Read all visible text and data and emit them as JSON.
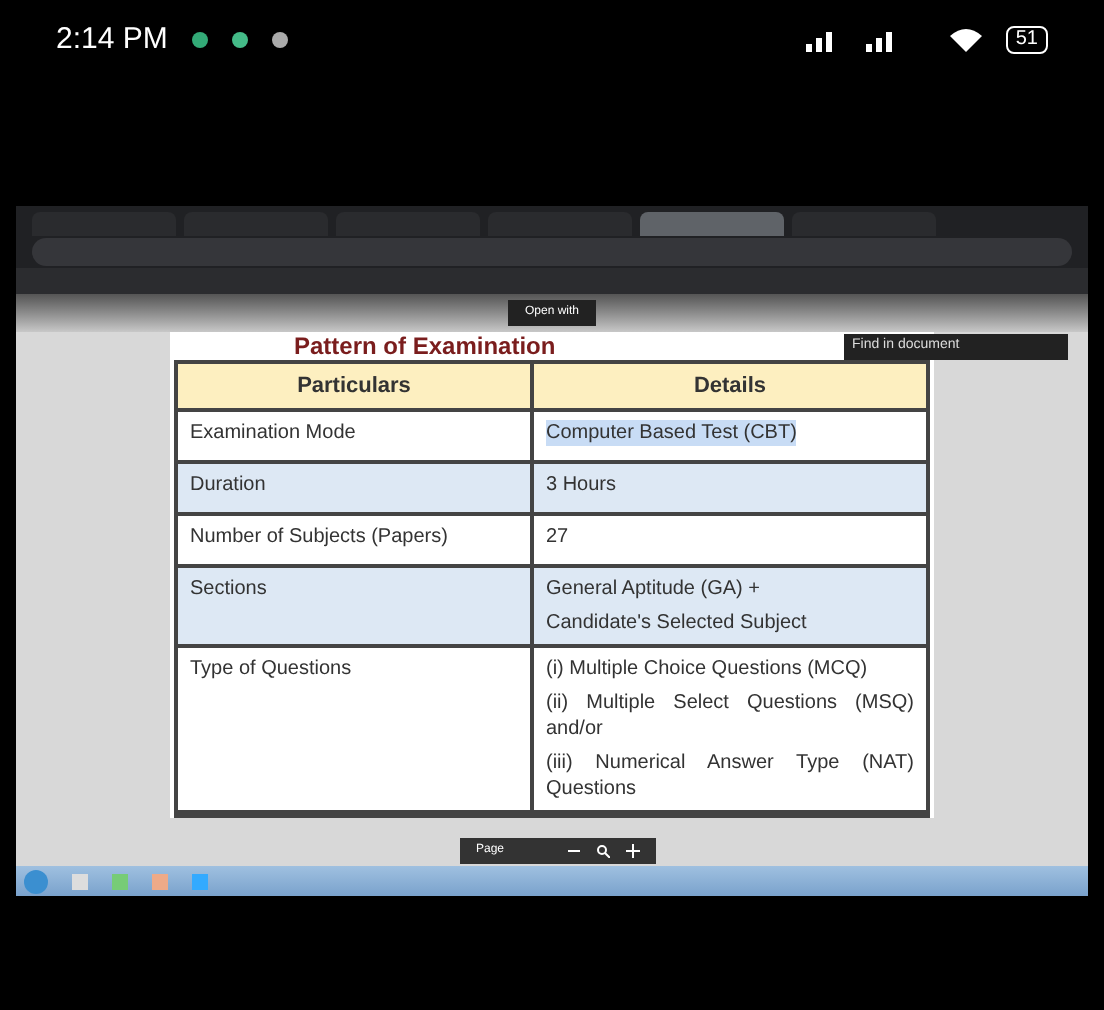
{
  "status_bar": {
    "time": "2:14 PM",
    "battery": "51"
  },
  "browser": {
    "tabs": [
      {
        "selected": false
      },
      {
        "selected": false
      },
      {
        "selected": false
      },
      {
        "selected": false
      },
      {
        "selected": true
      },
      {
        "selected": false
      }
    ],
    "pdf_toolbar": {
      "open_with": "Open with"
    },
    "find_box": {
      "placeholder": "Find in document"
    },
    "document": {
      "heading": "Pattern of Examination",
      "table": {
        "columns": [
          "Particulars",
          "Details"
        ],
        "rows": [
          {
            "shaded": false,
            "cells": [
              [
                "Examination Mode"
              ],
              [
                "Computer Based Test (CBT)"
              ]
            ],
            "text_selected": true
          },
          {
            "shaded": true,
            "cells": [
              [
                "Duration"
              ],
              [
                "3 Hours"
              ]
            ],
            "text_selected": false
          },
          {
            "shaded": false,
            "cells": [
              [
                "Number of Subjects (Papers)"
              ],
              [
                "27"
              ]
            ],
            "text_selected": false
          },
          {
            "shaded": true,
            "cells": [
              [
                "Sections"
              ],
              [
                "General Aptitude (GA) +",
                "Candidate's Selected Subject"
              ]
            ],
            "text_selected": false
          },
          {
            "shaded": false,
            "cells": [
              [
                "Type of Questions"
              ],
              [
                "(i) Multiple Choice Questions (MCQ)",
                "(ii) Multiple Select Questions (MSQ) and/or",
                "(iii) Numerical Answer Type (NAT) Questions"
              ]
            ],
            "text_selected": false
          }
        ]
      }
    },
    "page_controls": {
      "label": "Page"
    }
  }
}
